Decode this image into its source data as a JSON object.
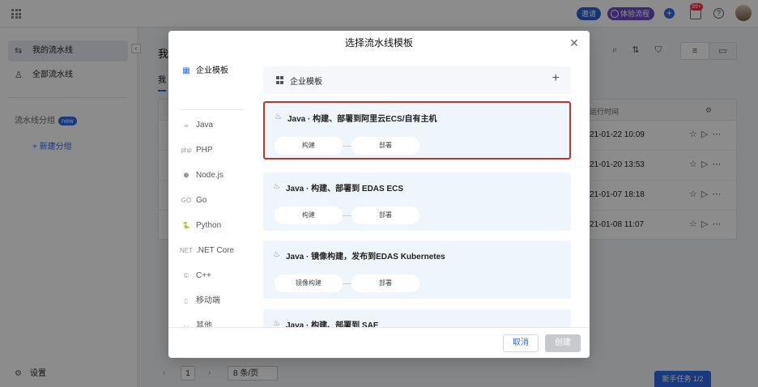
{
  "topbar": {
    "pill_a": "邀请",
    "pill_b": "体验流程",
    "bell_badge": "99+",
    "help": "?"
  },
  "sidebar": {
    "items": [
      {
        "label": "我的流水线"
      },
      {
        "label": "全部流水线"
      }
    ],
    "group_title": "流水线分组",
    "new_badge": "new",
    "add_group": "+ 新建分组",
    "settings": "设置"
  },
  "main": {
    "title": "我",
    "tab": "我",
    "rows": [
      {
        "time": "21-01-22 10:09"
      },
      {
        "time": "21-01-20 13:53"
      },
      {
        "time": "21-01-07 18:18"
      },
      {
        "time": "21-01-08 11:07"
      }
    ],
    "header_time": "运行时间",
    "pager": {
      "prev": "‹",
      "page": "1",
      "next": "›",
      "size": "8 条/页"
    },
    "newbie": "新手任务 1/2"
  },
  "modal": {
    "title": "选择流水线模板",
    "categories": [
      {
        "icon": "▦",
        "label": "企业模板"
      },
      {
        "icon": "☕",
        "label": "Java"
      },
      {
        "icon": "php",
        "label": "PHP"
      },
      {
        "icon": "⬢",
        "label": "Node.js"
      },
      {
        "icon": "GO",
        "label": "Go"
      },
      {
        "icon": "🐍",
        "label": "Python"
      },
      {
        "icon": "NET",
        "label": ".NET Core"
      },
      {
        "icon": "©",
        "label": "C++"
      },
      {
        "icon": "▯",
        "label": "移动端"
      },
      {
        "icon": "···",
        "label": "其他"
      }
    ],
    "enterprise_header": "企业模板",
    "templates": [
      {
        "title": "Java · 构建、部署到阿里云ECS/自有主机",
        "stages": [
          "构建",
          "部署"
        ]
      },
      {
        "title": "Java · 构建、部署到 EDAS ECS",
        "stages": [
          "构建",
          "部署"
        ]
      },
      {
        "title": "Java · 镜像构建，发布到EDAS Kubernetes",
        "stages": [
          "镜像构建",
          "部署"
        ]
      },
      {
        "title": "Java · 构建、部署到 SAE",
        "stages": []
      }
    ],
    "cancel": "取消",
    "create": "创建"
  }
}
